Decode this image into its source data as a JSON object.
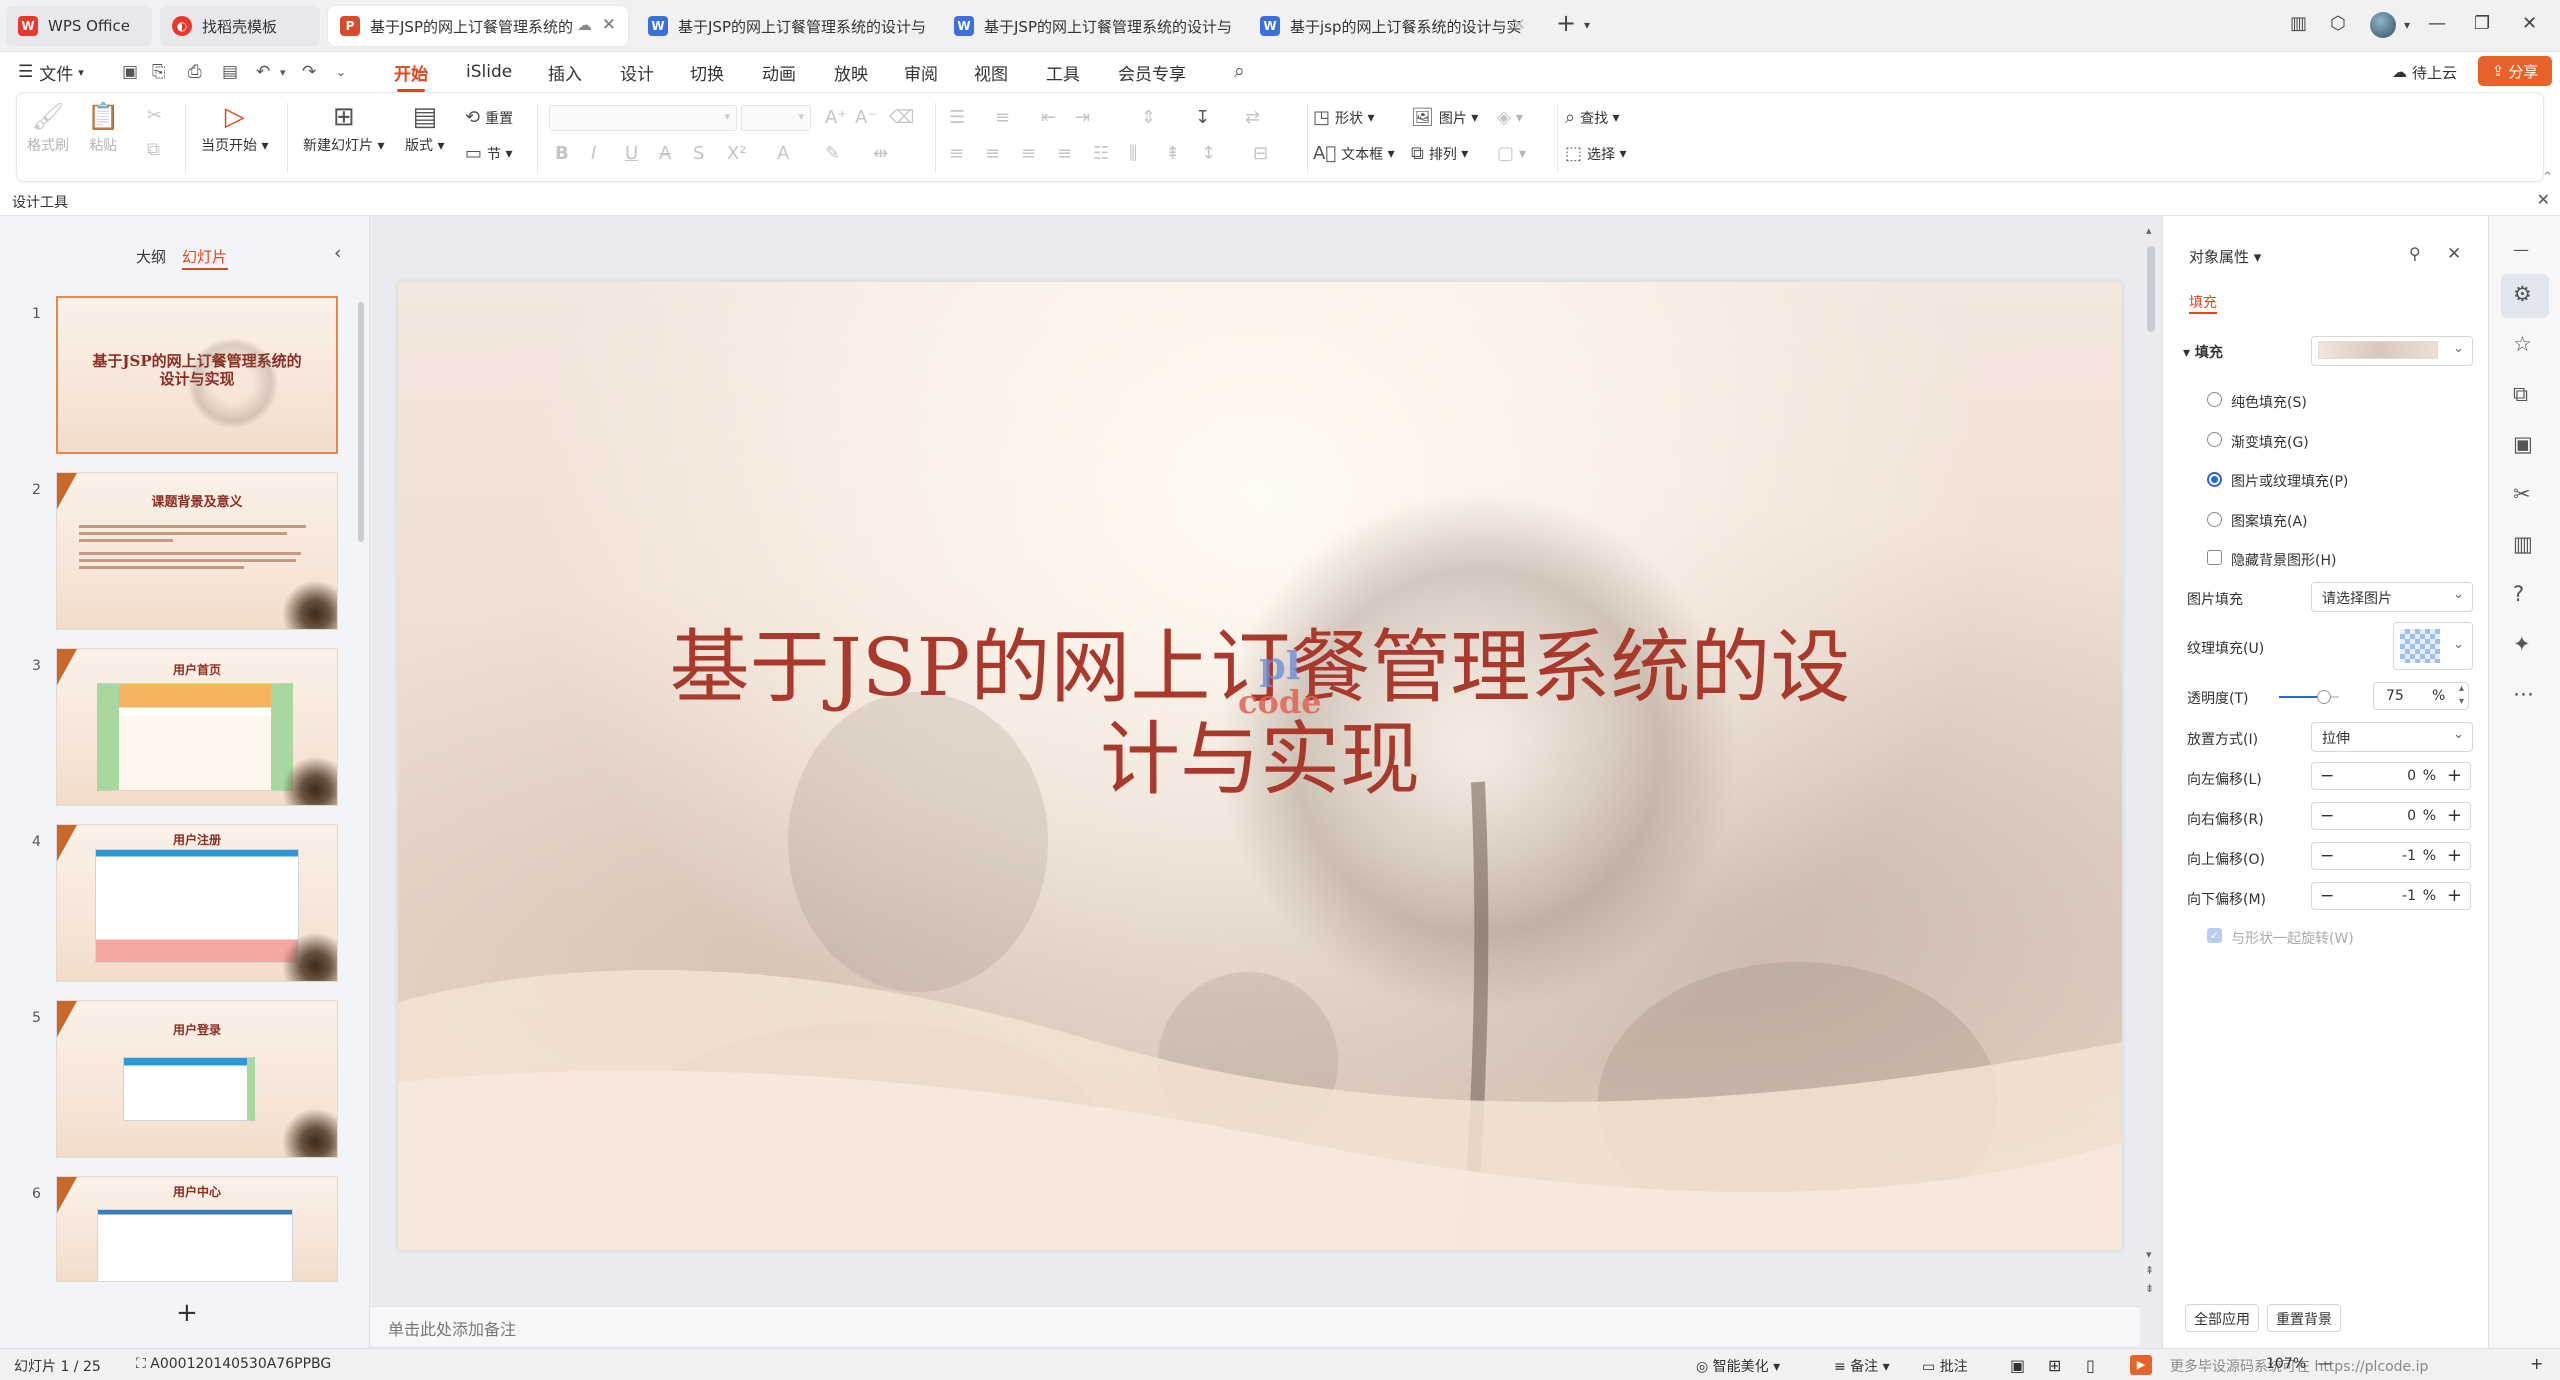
{
  "tabs": [
    {
      "label": "WPS Office",
      "icon": "wps-logo-icon",
      "color": "#e8382d"
    },
    {
      "label": "找稻壳模板",
      "icon": "docer-icon",
      "color": "#e8382d"
    },
    {
      "label": "基于JSP的网上订餐管理系统的",
      "icon": "ppt-icon",
      "color": "#d94a2b"
    },
    {
      "label": "基于JSP的网上订餐管理系统的设计与",
      "icon": "word-icon",
      "color": "#3b6fe0"
    },
    {
      "label": "基于JSP的网上订餐管理系统的设计与",
      "icon": "word-icon",
      "color": "#3b6fe0"
    },
    {
      "label": "基于jsp的网上订餐系统的设计与实",
      "icon": "word-icon",
      "color": "#3b6fe0"
    }
  ],
  "menu": {
    "file": "文件",
    "items": [
      "开始",
      "iSlide",
      "插入",
      "设计",
      "切换",
      "动画",
      "放映",
      "审阅",
      "视图",
      "工具",
      "会员专享"
    ],
    "active": "开始",
    "cloud": "待上云",
    "share": "分享"
  },
  "ribbon": {
    "format_painter": "格式刷",
    "paste": "粘贴",
    "play_from_current": "当页开始",
    "new_slide": "新建幻灯片",
    "layout": "版式",
    "reset": "重置",
    "section": "节",
    "shape": "形状",
    "picture": "图片",
    "textbox": "文本框",
    "arrange": "排列",
    "find": "查找",
    "select": "选择"
  },
  "subbar": {
    "label": "设计工具"
  },
  "leftpane": {
    "tab_outline": "大纲",
    "tab_slides": "幻灯片",
    "slides": [
      {
        "num": "1",
        "title": "基于JSP的网上订餐管理系统的设计与实现"
      },
      {
        "num": "2",
        "title": "课题背景及意义"
      },
      {
        "num": "3",
        "title": "用户首页"
      },
      {
        "num": "4",
        "title": "用户注册"
      },
      {
        "num": "5",
        "title": "用户登录"
      },
      {
        "num": "6",
        "title": "用户中心"
      }
    ]
  },
  "slide": {
    "title_line1": "基于JSP的网上订餐管理系统的设",
    "title_line2": "计与实现",
    "watermark_top": "pl",
    "watermark_bottom": "code"
  },
  "notes_placeholder": "单击此处添加备注",
  "props": {
    "panel_title": "对象属性",
    "tab_fill": "填充",
    "section_fill": "填充",
    "solid": "纯色填充(S)",
    "gradient": "渐变填充(G)",
    "picture_texture": "图片或纹理填充(P)",
    "pattern": "图案填充(A)",
    "hide_bg": "隐藏背景图形(H)",
    "picture_fill_label": "图片填充",
    "picture_fill_value": "请选择图片",
    "texture_fill_label": "纹理填充(U)",
    "transparency_label": "透明度(T)",
    "transparency_value": "75",
    "transparency_fraction": 0.75,
    "placement_label": "放置方式(I)",
    "placement_value": "拉伸",
    "offset_left_label": "向左偏移(L)",
    "offset_left": "0",
    "offset_right_label": "向右偏移(R)",
    "offset_right": "0",
    "offset_up_label": "向上偏移(O)",
    "offset_up": "-1",
    "offset_down_label": "向下偏移(M)",
    "offset_down": "-1",
    "percent": "%",
    "rotate_with_shape": "与形状一起旋转(W)",
    "apply_all": "全部应用",
    "reset_bg": "重置背景"
  },
  "status": {
    "slide_count": "幻灯片 1 / 25",
    "doc_id": "A000120140530A76PPBG",
    "beautify": "智能美化",
    "notes": "备注",
    "comments": "批注",
    "zoom": "107%",
    "overlay_text": "更多毕设源码系统可在 https://plcode.ip"
  }
}
